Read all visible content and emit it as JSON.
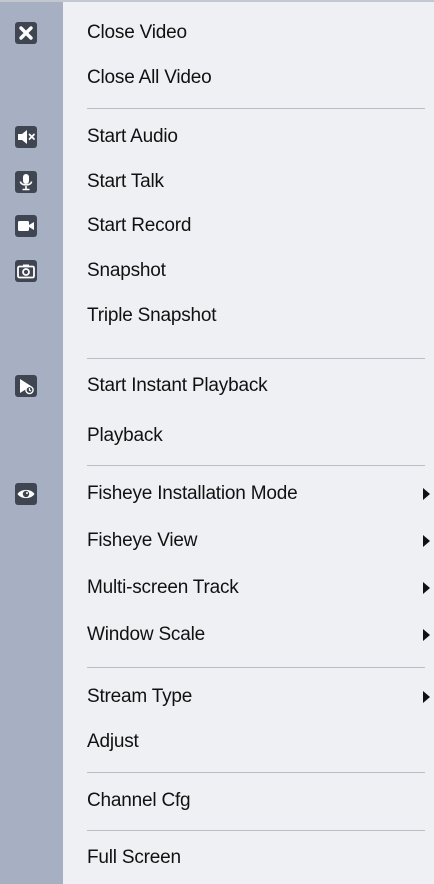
{
  "menu": {
    "items": [
      {
        "label": "Close Video",
        "icon": "close-icon"
      },
      {
        "label": "Close All Video"
      },
      {
        "label": "Start Audio",
        "icon": "speaker-muted-icon"
      },
      {
        "label": "Start Talk",
        "icon": "microphone-icon"
      },
      {
        "label": "Start Record",
        "icon": "video-camera-icon"
      },
      {
        "label": "Snapshot",
        "icon": "camera-icon"
      },
      {
        "label": "Triple Snapshot"
      },
      {
        "label": "Start Instant Playback",
        "icon": "instant-playback-icon"
      },
      {
        "label": "Playback"
      },
      {
        "label": "Fisheye Installation Mode",
        "icon": "fisheye-icon",
        "submenu": true
      },
      {
        "label": "Fisheye View",
        "submenu": true
      },
      {
        "label": "Multi-screen Track",
        "submenu": true
      },
      {
        "label": "Window Scale",
        "submenu": true
      },
      {
        "label": "Stream Type",
        "submenu": true
      },
      {
        "label": "Adjust"
      },
      {
        "label": "Channel Cfg"
      },
      {
        "label": "Full Screen"
      }
    ]
  },
  "colors": {
    "menu_background": "#eff0f4",
    "icon_gutter": "#a6b0c2",
    "icon_fill": "#3f4652",
    "separator": "#b8bdc6",
    "text": "#111111"
  }
}
